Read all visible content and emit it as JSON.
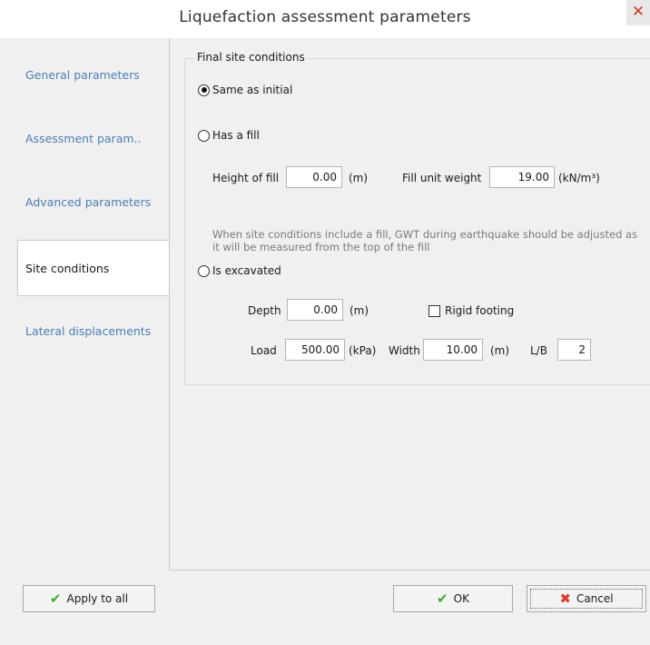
{
  "window": {
    "title": "Liquefaction assessment parameters",
    "close_symbol": "✕"
  },
  "sidebar": {
    "items": [
      {
        "label": "General parameters"
      },
      {
        "label": "Assessment param.."
      },
      {
        "label": "Advanced parameters"
      },
      {
        "label": "Site conditions"
      },
      {
        "label": "Lateral displacements"
      }
    ],
    "active_index": 3
  },
  "final_site": {
    "group_title": "Final site conditions",
    "options": {
      "same_as_initial": {
        "label": "Same as initial",
        "checked": true
      },
      "has_fill": {
        "label": "Has a fill",
        "checked": false
      },
      "is_excavated": {
        "label": "Is excavated",
        "checked": false
      }
    },
    "fill": {
      "height_label": "Height of fill",
      "height_value": "0.00",
      "height_unit": "(m)",
      "weight_label": "Fill unit weight",
      "weight_value": "19.00",
      "weight_unit": "(kN/m³)",
      "note": "When site conditions include a fill, GWT during earthquake should be adjusted as it will be measured from the top of the fill"
    },
    "excavation": {
      "depth_label": "Depth",
      "depth_value": "0.00",
      "depth_unit": "(m)",
      "rigid_footing_label": "Rigid footing",
      "rigid_footing_checked": false,
      "load_label": "Load",
      "load_value": "500.00",
      "load_unit": "(kPa)",
      "width_label": "Width",
      "width_value": "10.00",
      "width_unit": "(m)",
      "lb_label": "L/B",
      "lb_value": "2"
    }
  },
  "footer": {
    "apply_all_label": "Apply to all",
    "ok_label": "OK",
    "cancel_label": "Cancel"
  },
  "icons": {
    "check": "check-icon",
    "cross": "cross-icon"
  },
  "colors": {
    "link": "#4a7fb8",
    "ok_check": "#3cae2b",
    "cancel_x": "#e03a2a",
    "close_x": "#d9382c"
  }
}
